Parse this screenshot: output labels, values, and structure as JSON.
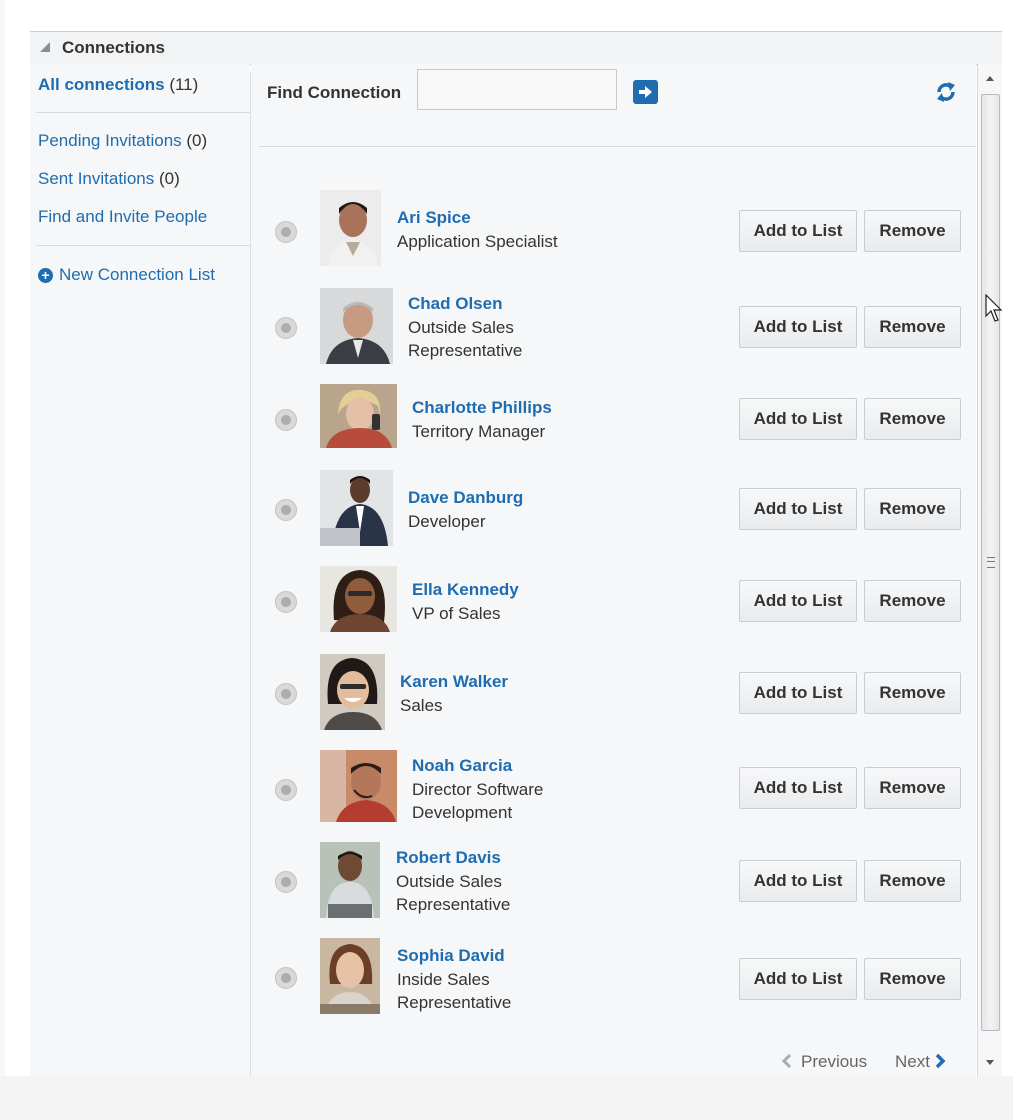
{
  "panel": {
    "title": "Connections"
  },
  "sidebar": {
    "all_connections": {
      "label": "All connections",
      "count": "(11)"
    },
    "pending_invitations": {
      "label": "Pending Invitations",
      "count": "(0)"
    },
    "sent_invitations": {
      "label": "Sent Invitations",
      "count": "(0)"
    },
    "find_invite": {
      "label": "Find and Invite People"
    },
    "new_list": {
      "label": "New Connection List"
    }
  },
  "search": {
    "label": "Find Connection",
    "value": "",
    "placeholder": ""
  },
  "buttons": {
    "add_to_list": "Add to List",
    "remove": "Remove"
  },
  "connections": [
    {
      "name": "Ari Spice",
      "title": "Application Specialist"
    },
    {
      "name": "Chad Olsen",
      "title": "Outside Sales Representative"
    },
    {
      "name": "Charlotte Phillips",
      "title": "Territory Manager"
    },
    {
      "name": "Dave Danburg",
      "title": "Developer"
    },
    {
      "name": "Ella Kennedy",
      "title": "VP of Sales"
    },
    {
      "name": "Karen Walker",
      "title": "Sales"
    },
    {
      "name": "Noah Garcia",
      "title": "Director Software Development"
    },
    {
      "name": "Robert Davis",
      "title": "Outside Sales Representative"
    },
    {
      "name": "Sophia David",
      "title": "Inside Sales Representative"
    }
  ],
  "pagination": {
    "previous": "Previous",
    "next": "Next"
  },
  "colors": {
    "link": "#1f6cb0",
    "text": "#333333",
    "panel_bg": "#f6f7f8"
  },
  "icons": {
    "collapse": "collapse-triangle-icon",
    "go": "arrow-right-icon",
    "refresh": "refresh-icon",
    "add": "plus-circle-icon",
    "previous": "chevron-left-icon",
    "next": "chevron-right-icon"
  }
}
